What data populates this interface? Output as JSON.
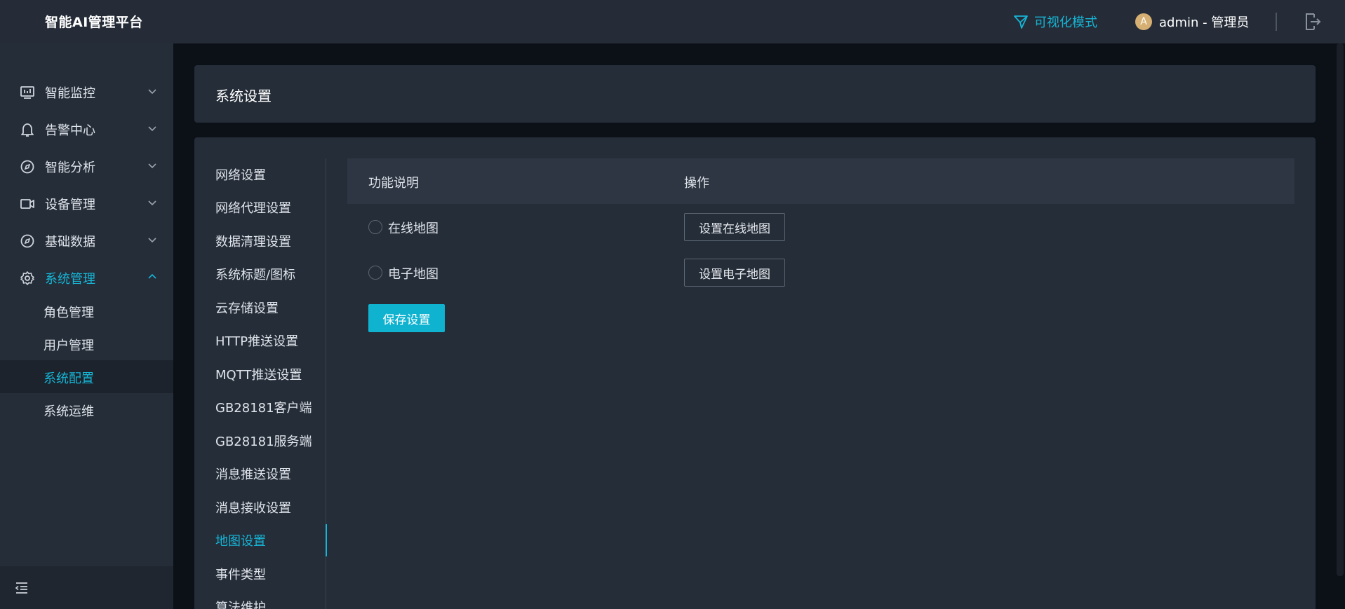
{
  "header": {
    "brand": "智能AI管理平台",
    "visual_mode_label": "可视化模式",
    "avatar_letter": "A",
    "user_label": "admin - 管理员"
  },
  "sidebar": {
    "items": [
      {
        "label": "智能监控",
        "icon": "monitor-icon"
      },
      {
        "label": "告警中心",
        "icon": "bell-icon"
      },
      {
        "label": "智能分析",
        "icon": "compass-icon"
      },
      {
        "label": "设备管理",
        "icon": "camera-icon"
      },
      {
        "label": "基础数据",
        "icon": "compass-icon"
      },
      {
        "label": "系统管理",
        "icon": "gear-icon",
        "expanded": true
      }
    ],
    "sub_items": [
      "角色管理",
      "用户管理",
      "系统配置",
      "系统运维"
    ],
    "selected_sub_item": "系统配置"
  },
  "page": {
    "title": "系统设置"
  },
  "settings_nav": {
    "items": [
      "网络设置",
      "网络代理设置",
      "数据清理设置",
      "系统标题/图标",
      "云存储设置",
      "HTTP推送设置",
      "MQTT推送设置",
      "GB28181客户端",
      "GB28181服务端",
      "消息推送设置",
      "消息接收设置",
      "地图设置",
      "事件类型",
      "算法维护"
    ],
    "active": "地图设置"
  },
  "map_settings": {
    "column_description": "功能说明",
    "column_action": "操作",
    "rows": [
      {
        "label": "在线地图",
        "button": "设置在线地图",
        "selected": false
      },
      {
        "label": "电子地图",
        "button": "设置电子地图",
        "selected": false
      }
    ],
    "save_label": "保存设置"
  },
  "colors": {
    "accent": "#16b5d6",
    "sidebar_bg": "#252d38",
    "page_bg": "#0c1017"
  }
}
